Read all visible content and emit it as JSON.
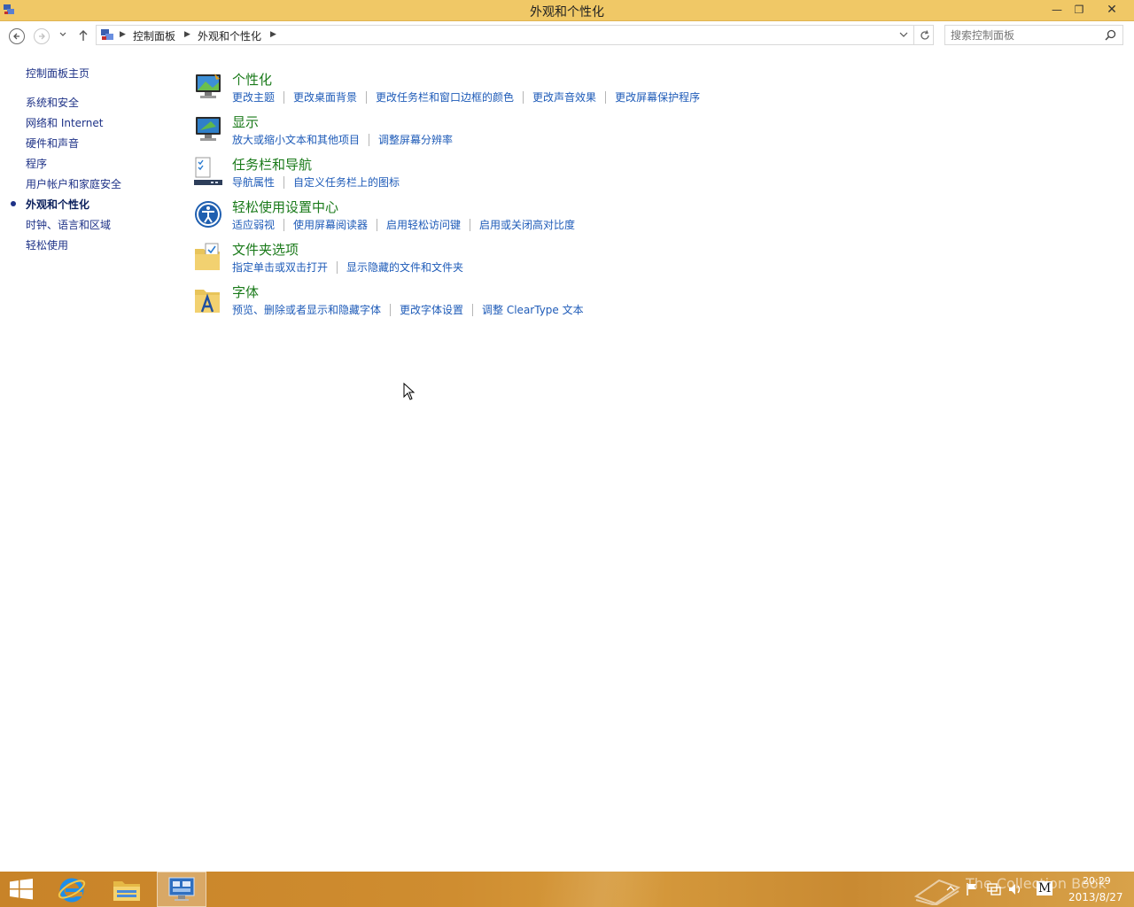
{
  "window": {
    "title": "外观和个性化",
    "minimize_glyph": "—",
    "maximize_glyph": "❐",
    "close_glyph": "✕"
  },
  "nav": {
    "breadcrumb": [
      "控制面板",
      "外观和个性化"
    ],
    "search_placeholder": "搜索控制面板"
  },
  "sidebar": {
    "home": "控制面板主页",
    "items": [
      {
        "label": "系统和安全",
        "current": false
      },
      {
        "label": "网络和 Internet",
        "current": false
      },
      {
        "label": "硬件和声音",
        "current": false
      },
      {
        "label": "程序",
        "current": false
      },
      {
        "label": "用户帐户和家庭安全",
        "current": false
      },
      {
        "label": "外观和个性化",
        "current": true
      },
      {
        "label": "时钟、语言和区域",
        "current": false
      },
      {
        "label": "轻松使用",
        "current": false
      }
    ]
  },
  "categories": [
    {
      "title": "个性化",
      "icon": "personalization-icon",
      "links": [
        "更改主题",
        "更改桌面背景",
        "更改任务栏和窗口边框的颜色",
        "更改声音效果",
        "更改屏幕保护程序"
      ]
    },
    {
      "title": "显示",
      "icon": "display-icon",
      "links": [
        "放大或缩小文本和其他项目",
        "调整屏幕分辨率"
      ]
    },
    {
      "title": "任务栏和导航",
      "icon": "taskbar-icon",
      "links": [
        "导航属性",
        "自定义任务栏上的图标"
      ]
    },
    {
      "title": "轻松使用设置中心",
      "icon": "ease-of-access-icon",
      "links": [
        "适应弱视",
        "使用屏幕阅读器",
        "启用轻松访问键",
        "启用或关闭高对比度"
      ]
    },
    {
      "title": "文件夹选项",
      "icon": "folder-options-icon",
      "links": [
        "指定单击或双击打开",
        "显示隐藏的文件和文件夹"
      ]
    },
    {
      "title": "字体",
      "icon": "fonts-icon",
      "links": [
        "预览、删除或者显示和隐藏字体",
        "更改字体设置",
        "调整 ClearType 文本"
      ]
    }
  ],
  "taskbar": {
    "watermark": "The Collection Book",
    "time": "20:29",
    "date": "2013/8/27",
    "ime": "M"
  },
  "colors": {
    "titlebar": "#f0c866",
    "link": "#1e5bb8",
    "category_title": "#1a7a1a",
    "sidebar_link": "#1e3287"
  }
}
